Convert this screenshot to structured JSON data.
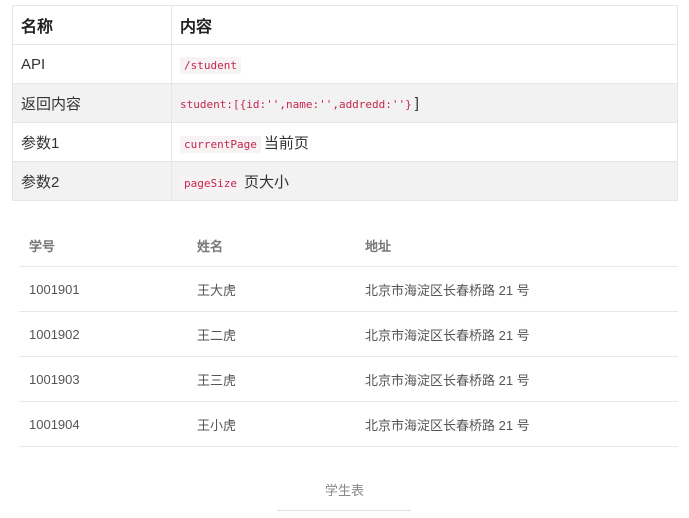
{
  "api_table": {
    "headers": [
      "名称",
      "内容"
    ],
    "rows": [
      {
        "name": "API",
        "code": "/student",
        "tail": ""
      },
      {
        "name": "返回内容",
        "code": "student:[{id:'',name:'',addredd:''}",
        "tail": "]"
      },
      {
        "name": "参数1",
        "code": "currentPage",
        "tail": "当前页"
      },
      {
        "name": "参数2",
        "code": "pageSize",
        "tail": "页大小"
      }
    ]
  },
  "student_table": {
    "headers": [
      "学号",
      "姓名",
      "地址"
    ],
    "rows": [
      [
        "1001901",
        "王大虎",
        "北京市海淀区长春桥路 21 号"
      ],
      [
        "1001902",
        "王二虎",
        "北京市海淀区长春桥路 21 号"
      ],
      [
        "1001903",
        "王三虎",
        "北京市海淀区长春桥路 21 号"
      ],
      [
        "1001904",
        "王小虎",
        "北京市海淀区长春桥路 21 号"
      ]
    ],
    "caption": "学生表"
  }
}
